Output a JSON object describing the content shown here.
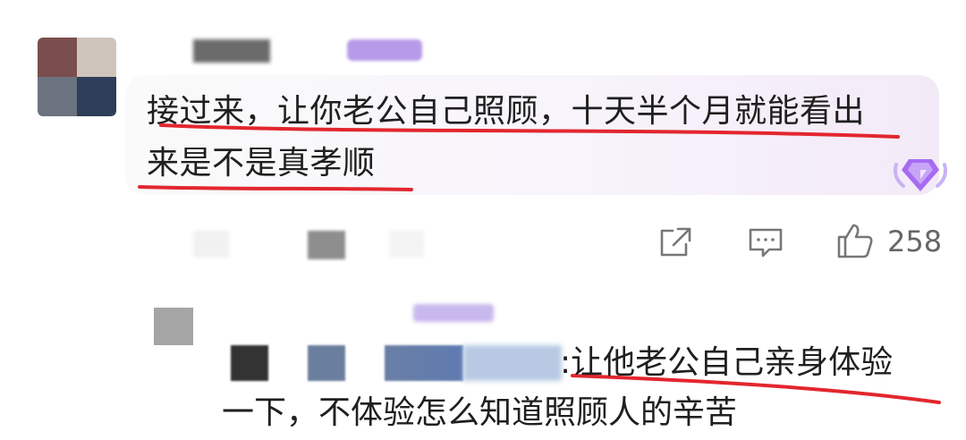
{
  "top_comment": {
    "text_line1": "接过来，让你老公自己照顾，十天半个月就能看出",
    "text_line2": "来是不是真孝顺",
    "like_count": "258",
    "badge_icon": "diamond-badge-icon",
    "actions": [
      "share-icon",
      "comment-icon",
      "thumbs-up-icon"
    ]
  },
  "reply": {
    "separator": ":",
    "text_line1": "让他老公自己亲身体验",
    "text_line2": "一下，不体验怎么知道照顾人的辛苦"
  },
  "colors": {
    "underline": "#e3262e",
    "badge": "#9b5cf0",
    "icon": "#777777"
  }
}
